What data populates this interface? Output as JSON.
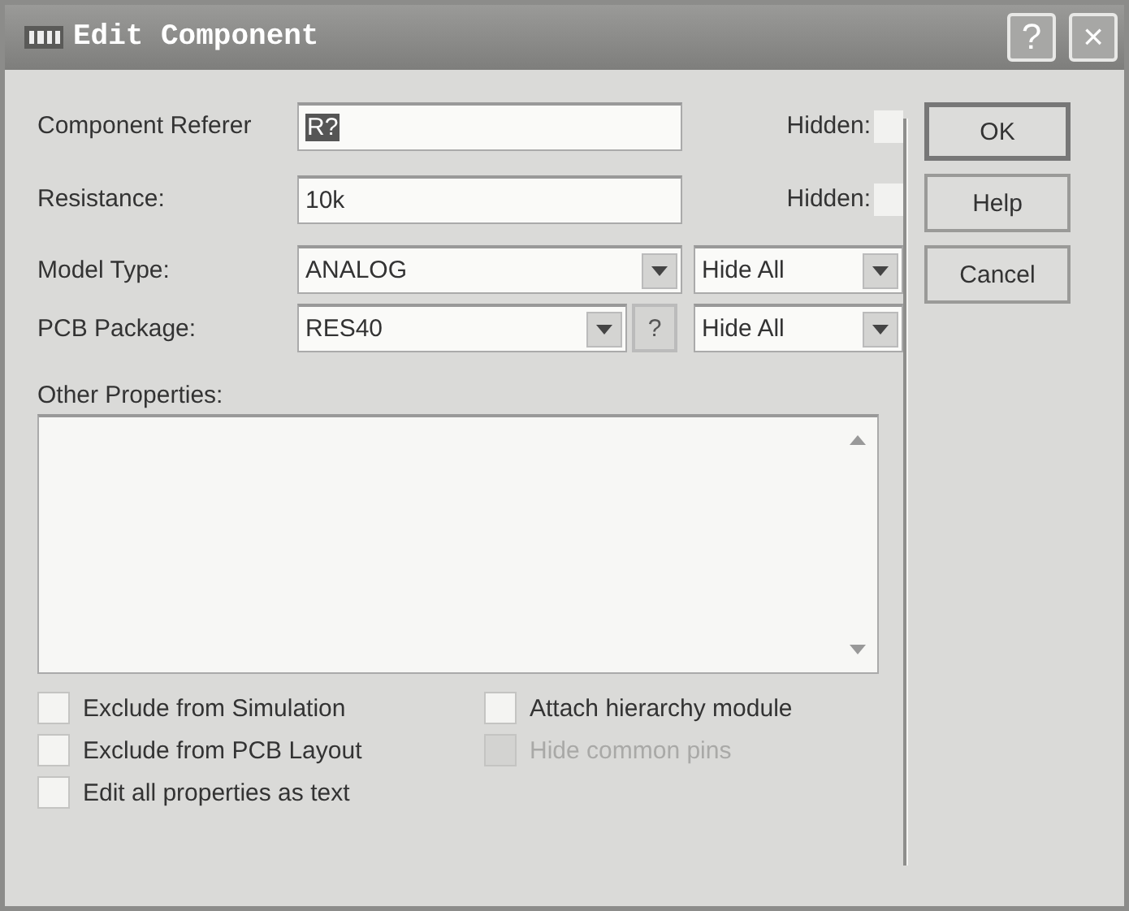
{
  "window": {
    "title": "Edit Component",
    "help_button": "?",
    "close_button": "×"
  },
  "fields": [
    {
      "label": "Component Referer",
      "value": "R?",
      "value_selected": true,
      "hidden_label": "Hidden:",
      "hidden": false
    },
    {
      "label": "Resistance:",
      "value": "10k",
      "value_selected": false,
      "hidden_label": "Hidden:",
      "hidden": false
    }
  ],
  "selects": [
    {
      "label": "Model Type:",
      "value": "ANALOG",
      "visibility": "Hide All"
    },
    {
      "label": "PCB Package:",
      "value": "RES40",
      "browse_button": "?",
      "visibility": "Hide All"
    }
  ],
  "other_properties": {
    "label": "Other Properties:"
  },
  "checkbox_columns": [
    [
      {
        "label": "Exclude from Simulation",
        "checked": false,
        "disabled": false
      },
      {
        "label": "Exclude from PCB Layout",
        "checked": false,
        "disabled": false
      },
      {
        "label": "Edit all properties as text",
        "checked": false,
        "disabled": false
      }
    ],
    [
      {
        "label": "Attach hierarchy module",
        "checked": false,
        "disabled": false
      },
      {
        "label": "Hide common pins",
        "checked": false,
        "disabled": true
      }
    ]
  ],
  "buttons": [
    "OK",
    "Help",
    "Cancel"
  ]
}
